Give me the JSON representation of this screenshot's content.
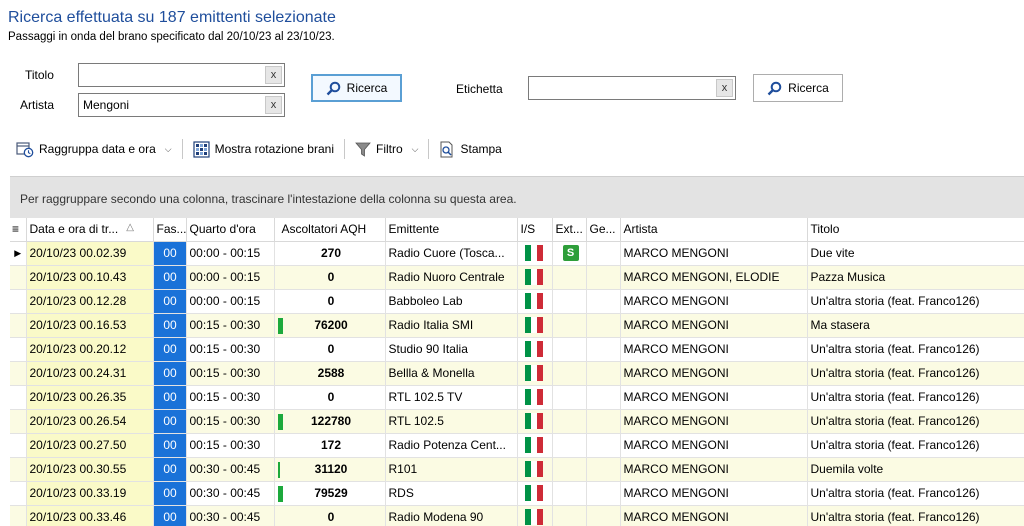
{
  "header": {
    "title": "Ricerca effettuata su 187 emittenti selezionate",
    "subtitle": "Passaggi in onda del brano specificato dal 20/10/23 al 23/10/23."
  },
  "form": {
    "titolo_label": "Titolo",
    "titolo_value": "",
    "artista_label": "Artista",
    "artista_value": "Mengoni",
    "etichetta_label": "Etichetta",
    "etichetta_value": "",
    "clear_glyph": "x",
    "search_label": "Ricerca"
  },
  "toolbar": {
    "group_label": "Raggruppa data e ora",
    "rotation_label": "Mostra rotazione brani",
    "filter_label": "Filtro",
    "print_label": "Stampa"
  },
  "group_hint": "Per raggruppare secondo una colonna, trascinare l'intestazione della colonna su questa area.",
  "columns": [
    "Data e ora di tr...",
    "Fas...",
    "Quarto d'ora",
    "Ascoltatori AQH",
    "Emittente",
    "I/S",
    "Ext...",
    "Ge...",
    "Artista",
    "Titolo"
  ],
  "rows": [
    {
      "date": "20/10/23  00.02.39",
      "fas": "00",
      "quarter": "00:00 - 00:15",
      "aqh": "270",
      "emittente": "Radio Cuore (Tosca...",
      "ext": "S",
      "artista": "MARCO MENGONI",
      "titolo": "Due vite"
    },
    {
      "date": "20/10/23  00.10.43",
      "fas": "00",
      "quarter": "00:00 - 00:15",
      "aqh": "0",
      "emittente": "Radio Nuoro Centrale",
      "ext": "",
      "artista": "MARCO MENGONI, ELODIE",
      "titolo": "Pazza Musica"
    },
    {
      "date": "20/10/23  00.12.28",
      "fas": "00",
      "quarter": "00:00 - 00:15",
      "aqh": "0",
      "emittente": "Babboleo Lab",
      "ext": "",
      "artista": "MARCO MENGONI",
      "titolo": "Un'altra storia (feat. Franco126)"
    },
    {
      "date": "20/10/23  00.16.53",
      "fas": "00",
      "quarter": "00:15 - 00:30",
      "aqh": "76200",
      "emittente": "Radio Italia SMI",
      "ext": "",
      "artista": "MARCO MENGONI",
      "titolo": "Ma stasera"
    },
    {
      "date": "20/10/23  00.20.12",
      "fas": "00",
      "quarter": "00:15 - 00:30",
      "aqh": "0",
      "emittente": "Studio 90 Italia",
      "ext": "",
      "artista": "MARCO MENGONI",
      "titolo": "Un'altra storia (feat. Franco126)"
    },
    {
      "date": "20/10/23  00.24.31",
      "fas": "00",
      "quarter": "00:15 - 00:30",
      "aqh": "2588",
      "emittente": "Bellla & Monella",
      "ext": "",
      "artista": "MARCO MENGONI",
      "titolo": "Un'altra storia (feat. Franco126)"
    },
    {
      "date": "20/10/23  00.26.35",
      "fas": "00",
      "quarter": "00:15 - 00:30",
      "aqh": "0",
      "emittente": "RTL 102.5 TV",
      "ext": "",
      "artista": "MARCO MENGONI",
      "titolo": "Un'altra storia (feat. Franco126)"
    },
    {
      "date": "20/10/23  00.26.54",
      "fas": "00",
      "quarter": "00:15 - 00:30",
      "aqh": "122780",
      "emittente": "RTL 102.5",
      "ext": "",
      "artista": "MARCO MENGONI",
      "titolo": "Un'altra storia (feat. Franco126)"
    },
    {
      "date": "20/10/23  00.27.50",
      "fas": "00",
      "quarter": "00:15 - 00:30",
      "aqh": "172",
      "emittente": "Radio Potenza Cent...",
      "ext": "",
      "artista": "MARCO MENGONI",
      "titolo": "Un'altra storia (feat. Franco126)"
    },
    {
      "date": "20/10/23  00.30.55",
      "fas": "00",
      "quarter": "00:30 - 00:45",
      "aqh": "31120",
      "emittente": "R101",
      "ext": "",
      "artista": "MARCO MENGONI",
      "titolo": "Duemila volte"
    },
    {
      "date": "20/10/23  00.33.19",
      "fas": "00",
      "quarter": "00:30 - 00:45",
      "aqh": "79529",
      "emittente": "RDS",
      "ext": "",
      "artista": "MARCO MENGONI",
      "titolo": "Un'altra storia (feat. Franco126)"
    },
    {
      "date": "20/10/23  00.33.46",
      "fas": "00",
      "quarter": "00:30 - 00:45",
      "aqh": "0",
      "emittente": "Radio Modena 90",
      "ext": "",
      "artista": "MARCO MENGONI",
      "titolo": "Un'altra storia (feat. Franco126)"
    }
  ],
  "colors": {
    "title": "#1f4e9c",
    "fascia_badge": "#1a72d8",
    "aqh_bar": "#1ca93c",
    "row_highlight": "#fbfbe3",
    "date_cell": "#fafac8",
    "flag_green": "#009246",
    "flag_white": "#ffffff",
    "flag_red": "#ce2b37",
    "ext_badge": "#2e9e3a"
  },
  "icons": {
    "search": "magnifier-icon",
    "group": "calendar-clock-icon",
    "rotation": "grid-icon",
    "filter": "funnel-icon",
    "print": "print-preview-icon"
  }
}
